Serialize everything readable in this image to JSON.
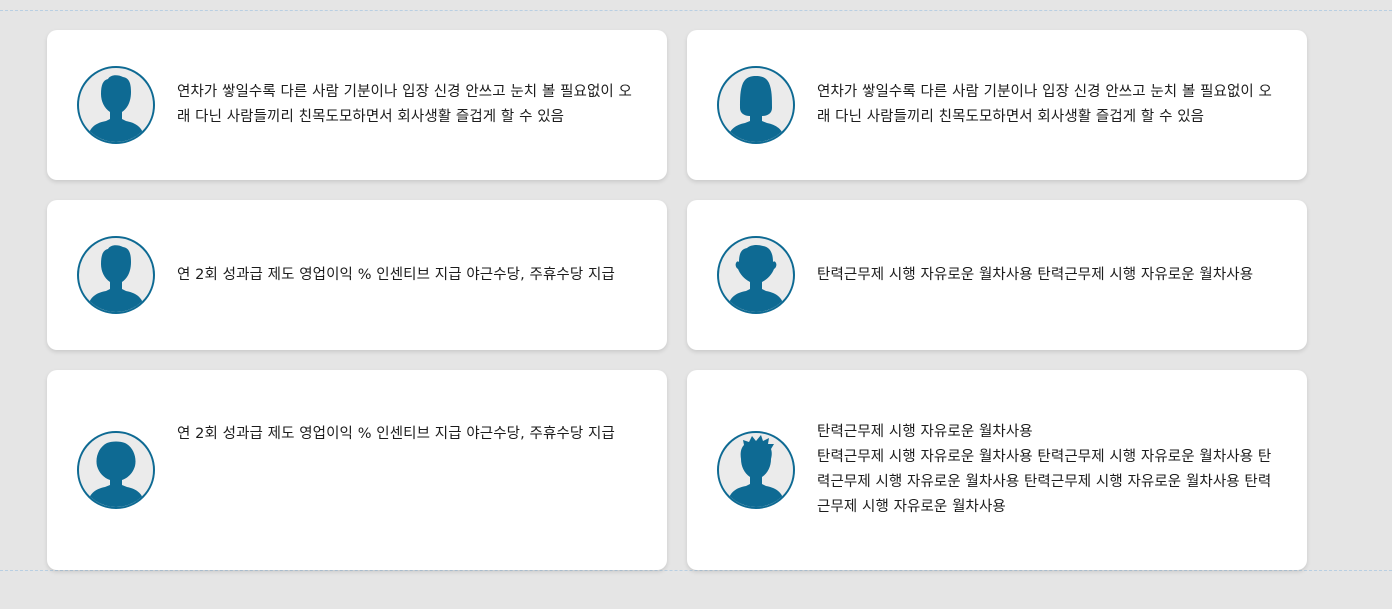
{
  "accent_color": "#0e6a93",
  "background_color": "#e5e5e5",
  "cards": [
    {
      "icon": "male-avatar-icon",
      "text": "연차가 쌓일수록 다른 사람 기분이나 입장 신경 안쓰고 눈치 볼 필요없이 오래 다닌 사람들끼리 친목도모하면서 회사생활 즐겁게 할 수 있음"
    },
    {
      "icon": "female-avatar-icon",
      "text": "연차가 쌓일수록 다른 사람 기분이나 입장 신경 안쓰고 눈치 볼 필요없이 오래 다닌 사람들끼리 친목도모하면서 회사생활 즐겁게 할 수 있음"
    },
    {
      "icon": "male-avatar-icon",
      "text": "연 2회 성과급 제도 영업이익 % 인센티브 지급 야근수당, 주휴수당 지급"
    },
    {
      "icon": "male-avatar-icon",
      "text": "탄력근무제 시행 자유로운 월차사용 탄력근무제 시행 자유로운 월차사용"
    },
    {
      "icon": "female-short-hair-avatar-icon",
      "text": "연 2회 성과급 제도 영업이익 % 인센티브 지급 야근수당, 주휴수당 지급"
    },
    {
      "icon": "male-spiky-hair-avatar-icon",
      "text_lines": [
        "탄력근무제 시행 자유로운 월차사용",
        "탄력근무제 시행 자유로운 월차사용 탄력근무제 시행 자유로운 월차사용 탄력근무제 시행 자유로운 월차사용 탄력근무제 시행 자유로운 월차사용 탄력근무제 시행 자유로운 월차사용"
      ]
    }
  ]
}
